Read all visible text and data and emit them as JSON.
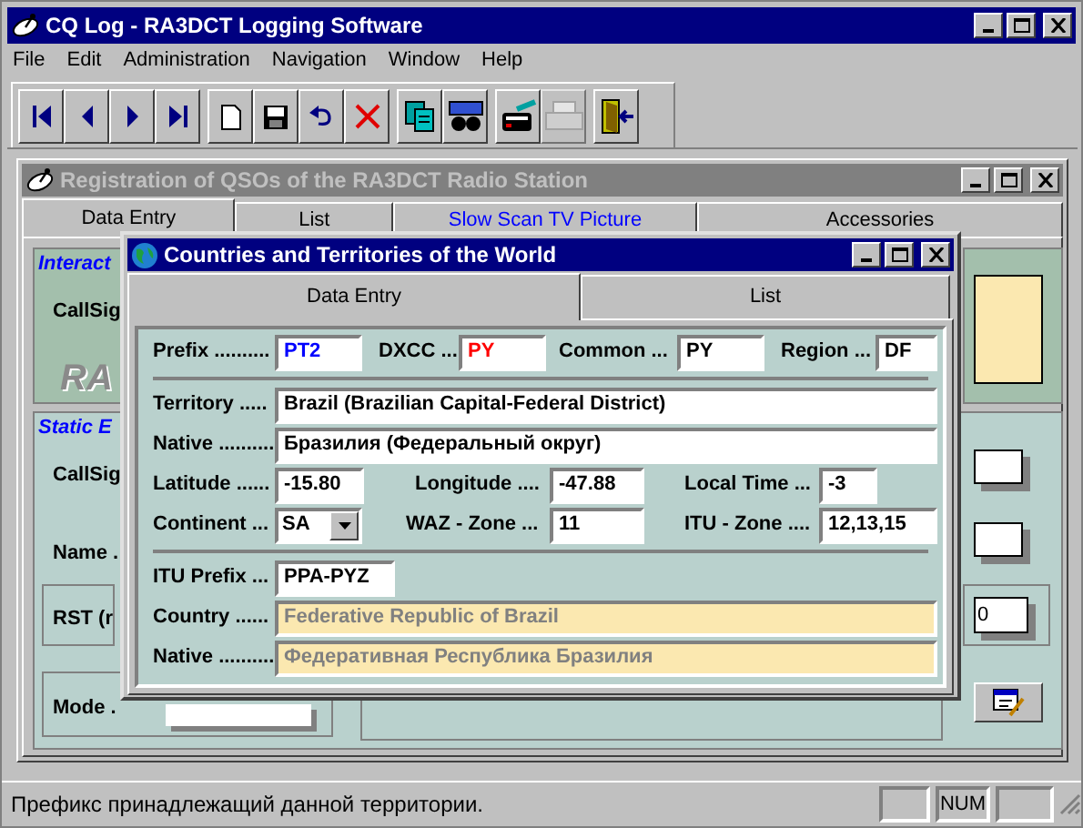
{
  "app": {
    "title": "CQ Log - RA3DCT Logging Software"
  },
  "menu": [
    "File",
    "Edit",
    "Administration",
    "Navigation",
    "Window",
    "Help"
  ],
  "toolbar": [
    [
      {
        "kind": "first"
      },
      {
        "kind": "prev"
      },
      {
        "kind": "next"
      },
      {
        "kind": "last"
      }
    ],
    [
      {
        "kind": "new"
      },
      {
        "kind": "save"
      },
      {
        "kind": "undo"
      },
      {
        "kind": "delete"
      }
    ],
    [
      {
        "kind": "copy"
      },
      {
        "kind": "find"
      }
    ],
    [
      {
        "kind": "tools"
      },
      {
        "kind": "print",
        "disabled": true
      }
    ],
    [
      {
        "kind": "exit"
      }
    ]
  ],
  "child_window": {
    "title": "Registration of QSOs of the RA3DCT Radio Station",
    "tabs": [
      {
        "label": "Data Entry",
        "selected": true
      },
      {
        "label": "List",
        "selected": false
      },
      {
        "label": "Slow Scan TV Picture",
        "selected": false,
        "kind": "link"
      },
      {
        "label": "Accessories",
        "selected": false
      }
    ],
    "interactive_panel": {
      "title": "Interact",
      "callsign_label": "CallSig",
      "watermark_text": "RA"
    },
    "static_panel": {
      "title": "Static E",
      "callsign_label": "CallSig",
      "name_label": "Name .",
      "rst_label": "RST (r",
      "rst_value": "0",
      "mode_label": "Mode ."
    }
  },
  "dialog": {
    "title": "Countries and Territories of the World",
    "tabs": [
      {
        "label": "Data Entry",
        "selected": true
      },
      {
        "label": "List",
        "selected": false
      }
    ],
    "sections": [
      [
        [
          {
            "label": "Prefix ..........",
            "value": "PT2",
            "color": "#0000ff"
          },
          {
            "label": "DXCC ...",
            "value": "PY",
            "color": "#ff0000"
          },
          {
            "label": "Common ...",
            "value": "PY",
            "color": "#000000"
          },
          {
            "label": "Region ...",
            "value": "DF",
            "color": "#000000"
          }
        ]
      ],
      [
        [
          {
            "label": "Territory .....",
            "value": "Brazil (Brazilian Capital-Federal District)",
            "color": "#000000"
          }
        ],
        [
          {
            "label": "Native ..........",
            "value": "Бразилия (Федеральный округ)",
            "color": "#000000"
          }
        ],
        [
          {
            "label": "Latitude ......",
            "value": "-15.80",
            "color": "#000000"
          },
          {
            "label": "Longitude ....",
            "value": "-47.88",
            "color": "#000000"
          },
          {
            "label": "Local Time ...",
            "value": "-3",
            "color": "#000000"
          }
        ],
        [
          {
            "label": "Continent ...",
            "value": "SA",
            "color": "#000000",
            "kind": "combo"
          },
          {
            "label": "WAZ - Zone ...",
            "value": "11",
            "color": "#000000"
          },
          {
            "label": "ITU - Zone ....",
            "value": "12,13,15",
            "color": "#000000"
          }
        ]
      ],
      [
        [
          {
            "label": "ITU Prefix ...",
            "value": "PPA-PYZ",
            "color": "#000000"
          }
        ],
        [
          {
            "label": "Country ......",
            "value": "Federative Republic of Brazil",
            "color": "#808080",
            "kind": "readonly"
          }
        ],
        [
          {
            "label": "Native ..........",
            "value": "Федеративная Республика Бразилия",
            "color": "#808080",
            "kind": "readonly"
          }
        ]
      ]
    ]
  },
  "status_bar": {
    "message": "Префикс принадлежащий данной территории.",
    "indicator": "NUM"
  }
}
